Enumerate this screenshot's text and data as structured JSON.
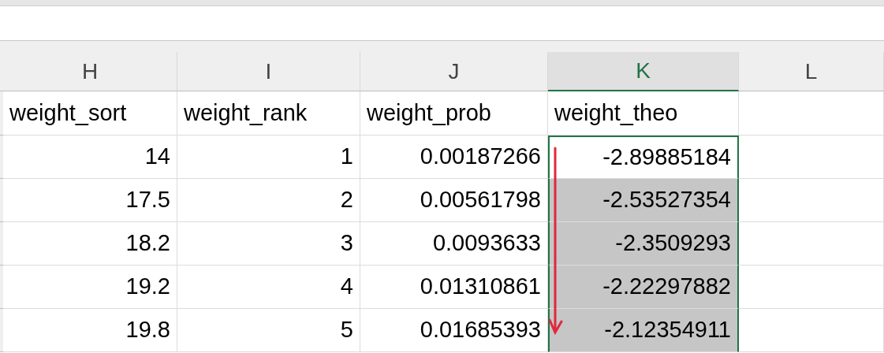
{
  "columns": [
    {
      "letter": "H",
      "selected": false
    },
    {
      "letter": "I",
      "selected": false
    },
    {
      "letter": "J",
      "selected": false
    },
    {
      "letter": "K",
      "selected": true
    },
    {
      "letter": "L",
      "selected": false
    }
  ],
  "header_row": [
    "weight_sort",
    "weight_rank",
    "weight_prob",
    "weight_theo"
  ],
  "rows": [
    {
      "cells": [
        "14",
        "1",
        "0.00187266",
        "-2.89885184"
      ],
      "highlighted": false
    },
    {
      "cells": [
        "17.5",
        "2",
        "0.00561798",
        "-2.53527354"
      ],
      "highlighted": true
    },
    {
      "cells": [
        "18.2",
        "3",
        "0.0093633",
        "-2.3509293"
      ],
      "highlighted": true
    },
    {
      "cells": [
        "19.2",
        "4",
        "0.01310861",
        "-2.22297882"
      ],
      "highlighted": true
    },
    {
      "cells": [
        "19.8",
        "5",
        "0.01685393",
        "-2.12354911"
      ],
      "highlighted": true
    }
  ]
}
